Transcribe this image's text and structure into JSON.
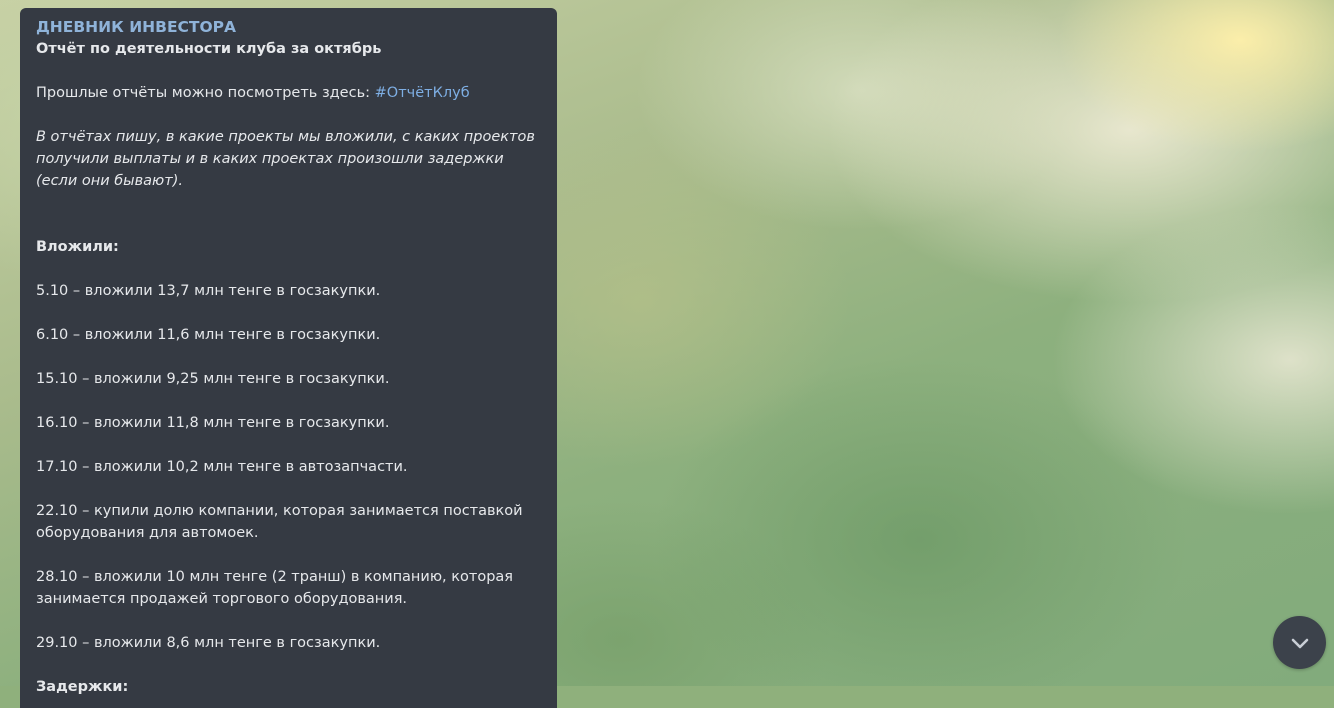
{
  "message": {
    "channel_name": "ДНЕВНИК ИНВЕСТОРА",
    "title": "Отчёт по деятельности клуба за октябрь",
    "past_reports_text": "Прошлые отчёты можно посмотреть здесь: ",
    "past_reports_hashtag": "#ОтчётКлуб",
    "intro_italic": "В отчётах пишу, в какие проекты мы вложили, с каких проектов получили выплаты и в каких проектах произошли задержки (если они бывают).",
    "invested_heading": "Вложили:",
    "items": [
      "5.10 – вложили 13,7 млн тенге в госзакупки.",
      "6.10 – вложили 11,6 млн тенге в госзакупки.",
      "15.10 – вложили 9,25 млн тенге в госзакупки.",
      "16.10 – вложили 11,8 млн тенге в госзакупки.",
      "17.10 – вложили 10,2 млн тенге в автозапчасти.",
      "22.10 – купили долю компании, которая занимается поставкой оборудования для автомоек.",
      "28.10 – вложили 10 млн тенге (2 транш) в компанию, которая занимается продажей торгового оборудования.",
      "29.10 – вложили 8,6 млн тенге в госзакупки."
    ],
    "delays_heading": "Задержки:"
  },
  "scroll_button": {
    "icon": "chevron-down-icon"
  },
  "colors": {
    "bubble": "#353a43",
    "channel_name": "#8fb3d9",
    "hashtag": "#7eaee3",
    "text": "#e6e8eb"
  }
}
